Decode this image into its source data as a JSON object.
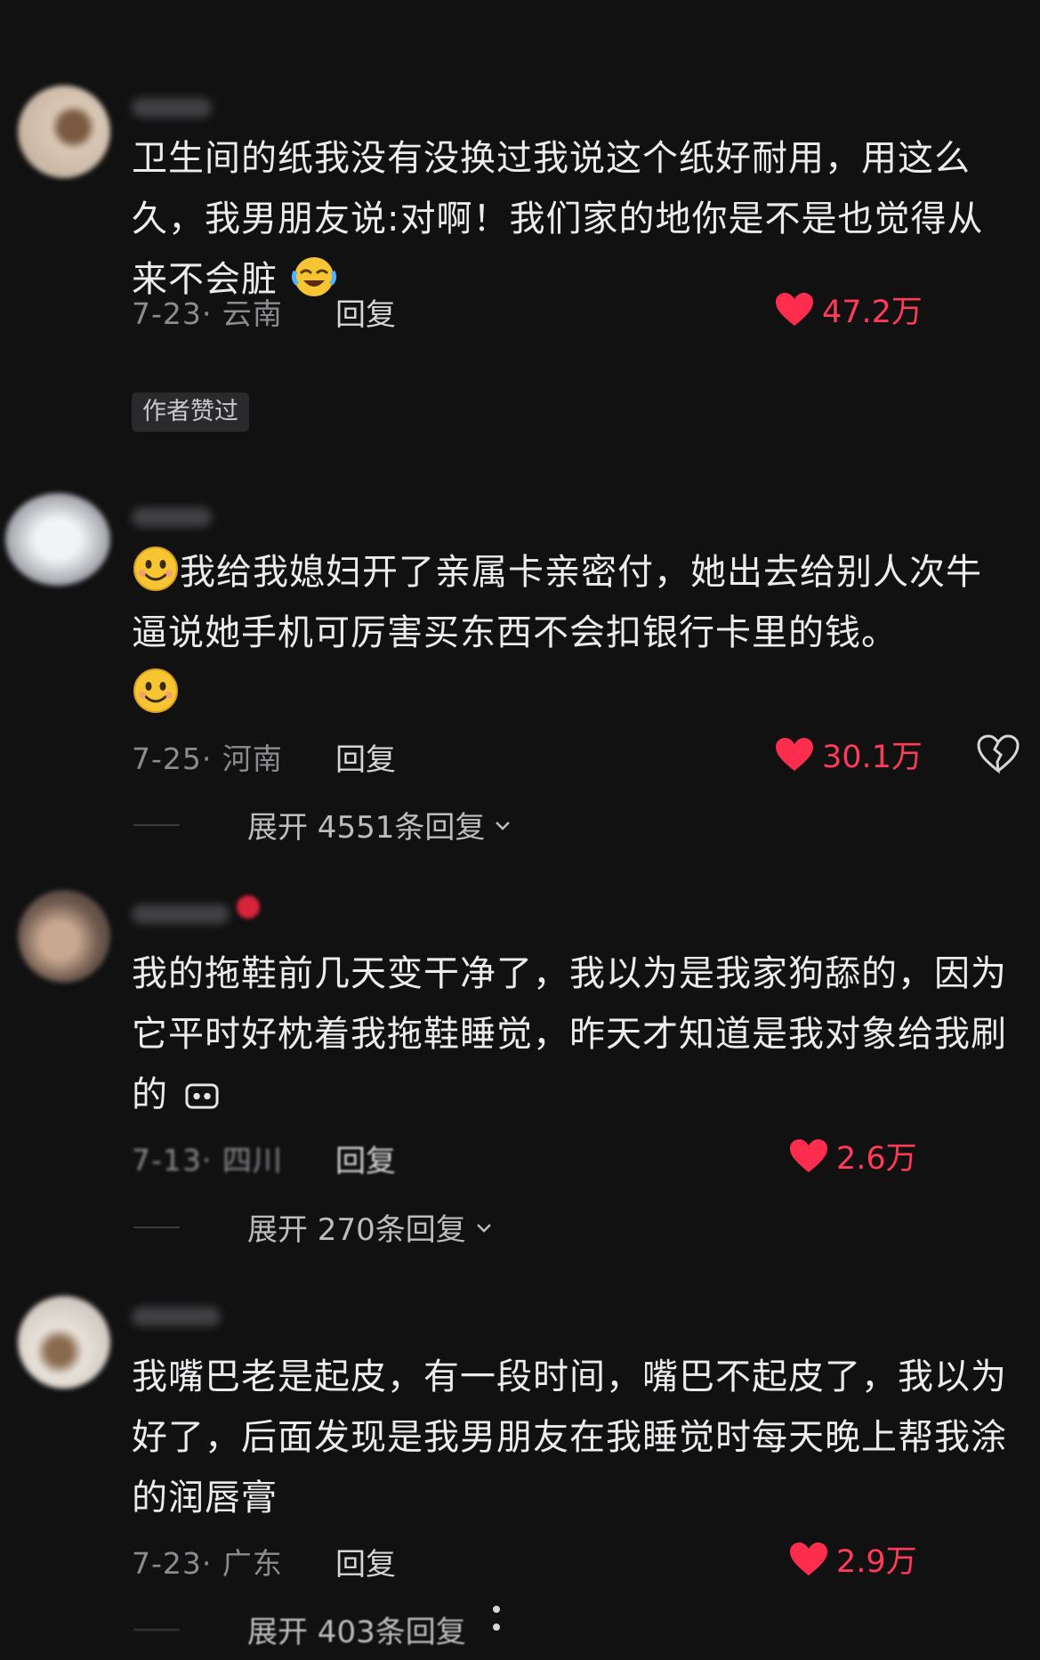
{
  "comments": [
    {
      "text": "卫生间的纸我没有没换过我说这个纸好耐用，用这么久，我男朋友说:对啊！我们家的地你是不是也觉得从来不会脏",
      "date_location": "7-23· 云南",
      "reply_label": "回复",
      "likes": "47.2万",
      "badge": "作者赞过",
      "emoji": "crying-laughing-face-icon"
    },
    {
      "text": "我给我媳妇开了亲属卡亲密付，她出去给别人次牛逼说她手机可厉害买东西不会扣银行卡里的钱。",
      "date_location": "7-25· 河南",
      "reply_label": "回复",
      "likes": "30.1万",
      "expand_label": "展开 4551条回复",
      "emoji": "smiling-face-icon"
    },
    {
      "text": "我的拖鞋前几天变干净了，我以为是我家狗舔的，因为它平时好枕着我拖鞋睡觉，昨天才知道是我对象给我刷的",
      "date_location": "7-13· 四川",
      "reply_label": "回复",
      "likes": "2.6万",
      "expand_label": "展开 270条回复"
    },
    {
      "text": "我嘴巴老是起皮，有一段时间，嘴巴不起皮了，我以为好了，后面发现是我男朋友在我睡觉时每天晚上帮我涂的润唇膏",
      "date_location": "7-23· 广东",
      "reply_label": "回复",
      "likes": "2.9万",
      "expand_label": "展开 403条回复"
    }
  ],
  "colors": {
    "background": "#111112",
    "like_red": "#ff3b58",
    "meta_gray": "#8c8c90"
  }
}
